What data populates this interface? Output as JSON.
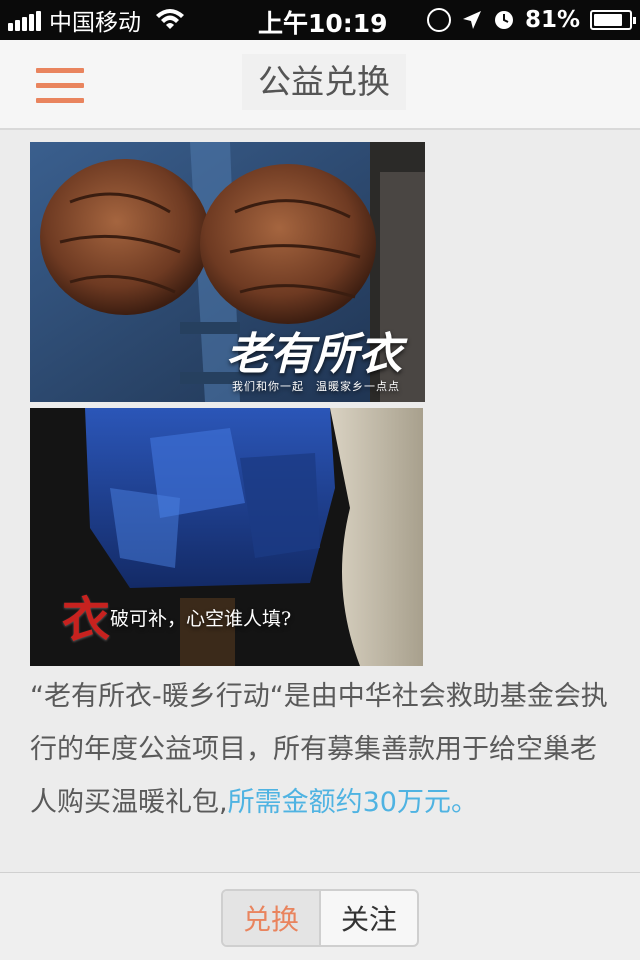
{
  "status_bar": {
    "carrier": "中国移动",
    "time": "上午10:19",
    "battery": "81%",
    "battery_level": 0.81
  },
  "nav": {
    "title": "公益兑换",
    "menu_icon": "hamburger-menu-icon",
    "accent_color": "#e9845e"
  },
  "photos": [
    {
      "caption_title": "老有所衣",
      "caption_sub": "我们和你一起　温暖家乡一点点"
    },
    {
      "caption_char": "衣",
      "caption_text": "破可补，心空谁人填?"
    }
  ],
  "description": {
    "text": "“老有所衣-暖乡行动“是由中华社会救助基金会执行的年度公益项目，所有募集善款用于给空巢老人购买温暖礼包,",
    "highlight": "所需金额约30万元。",
    "highlight_color": "#4fb3e2"
  },
  "bottom_bar": {
    "tabs": [
      {
        "label": "兑换",
        "active": true
      },
      {
        "label": "关注",
        "active": false
      }
    ]
  }
}
